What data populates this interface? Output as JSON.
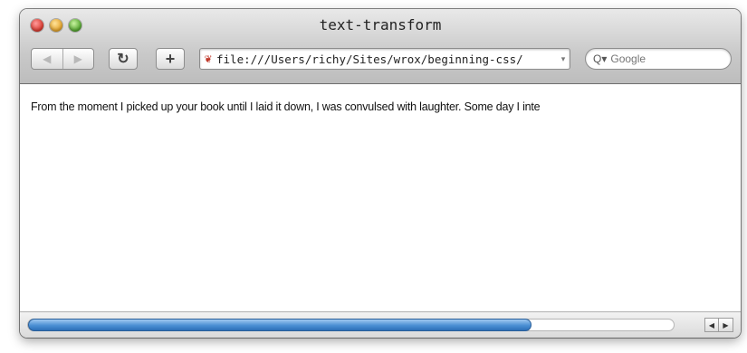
{
  "window": {
    "title": "text-transform"
  },
  "toolbar": {
    "back_icon": "back-arrow-icon",
    "forward_icon": "forward-arrow-icon",
    "reload_icon": "reload-icon",
    "add_bookmark_icon": "plus-icon",
    "address": "file:///Users/richy/Sites/wrox/beginning-css/",
    "search_placeholder": "Google"
  },
  "content": {
    "paragraph": "From the moment I picked up your book until I laid it down, I was convulsed with laughter. Some day I inte"
  },
  "scrollbar": {
    "horizontal_position_fraction": 0.78
  },
  "colors": {
    "thumb": "#4a8fd4",
    "close": "#d9362b",
    "minimize": "#e3a126",
    "zoom": "#4fa32a"
  }
}
